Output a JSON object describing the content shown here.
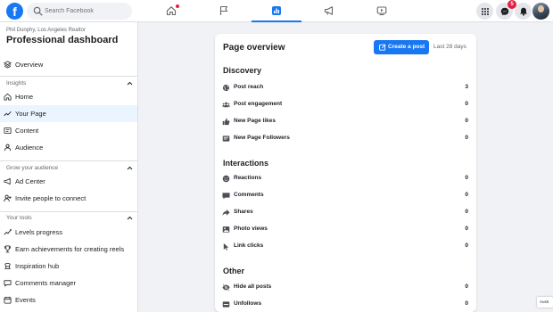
{
  "topbar": {
    "logo": "f",
    "search_placeholder": "Search Facebook",
    "tabs": [
      {
        "icon": "home-icon",
        "active": false,
        "has_dot": true
      },
      {
        "icon": "flag-icon",
        "active": false,
        "has_dot": false
      },
      {
        "icon": "dashboard-icon",
        "active": true,
        "has_dot": false
      },
      {
        "icon": "megaphone-icon",
        "active": false,
        "has_dot": false
      },
      {
        "icon": "video-icon",
        "active": false,
        "has_dot": false
      }
    ],
    "right": {
      "menu_icon": "grid-menu-icon",
      "messenger_icon": "messenger-icon",
      "messenger_badge": "5",
      "notifications_icon": "bell-icon"
    },
    "accent": "#1877f2"
  },
  "sidebar": {
    "profile_subtitle": "Phil Dunphy, Los Angeles Realtor",
    "title": "Professional dashboard",
    "overview_label": "Overview",
    "insights_header": "Insights",
    "insights_items": [
      {
        "label": "Home",
        "icon": "home-icon"
      },
      {
        "label": "Your Page",
        "icon": "trend-icon",
        "active": true
      },
      {
        "label": "Content",
        "icon": "content-icon"
      },
      {
        "label": "Audience",
        "icon": "audience-icon"
      }
    ],
    "grow_header": "Grow your audience",
    "grow_items": [
      {
        "label": "Ad Center",
        "icon": "megaphone-icon"
      },
      {
        "label": "Invite people to connect",
        "icon": "invite-icon"
      }
    ],
    "tools_header": "Your tools",
    "tools_items": [
      {
        "label": "Levels progress",
        "icon": "levels-icon"
      },
      {
        "label": "Earn achievements for creating reels",
        "icon": "trophy-icon"
      },
      {
        "label": "Inspiration hub",
        "icon": "bulb-icon"
      },
      {
        "label": "Comments manager",
        "icon": "comments-icon"
      },
      {
        "label": "Events",
        "icon": "calendar-icon"
      }
    ]
  },
  "overview": {
    "title": "Page overview",
    "create_button": "Create a post",
    "range": "Last 28 days",
    "groups": [
      {
        "title": "Discovery",
        "metrics": [
          {
            "label": "Post reach",
            "value": "3",
            "icon": "globe-icon"
          },
          {
            "label": "Post engagement",
            "value": "0",
            "icon": "people-icon"
          },
          {
            "label": "New Page likes",
            "value": "0",
            "icon": "thumbs-up-icon"
          },
          {
            "label": "New Page Followers",
            "value": "0",
            "icon": "followers-icon"
          }
        ]
      },
      {
        "title": "Interactions",
        "metrics": [
          {
            "label": "Reactions",
            "value": "0",
            "icon": "smiley-icon"
          },
          {
            "label": "Comments",
            "value": "0",
            "icon": "comment-icon"
          },
          {
            "label": "Shares",
            "value": "0",
            "icon": "share-icon"
          },
          {
            "label": "Photo views",
            "value": "0",
            "icon": "photo-icon"
          },
          {
            "label": "Link clicks",
            "value": "0",
            "icon": "cursor-icon"
          }
        ]
      },
      {
        "title": "Other",
        "metrics": [
          {
            "label": "Hide all posts",
            "value": "0",
            "icon": "hide-icon"
          },
          {
            "label": "Unfollows",
            "value": "0",
            "icon": "unfollow-icon"
          }
        ]
      }
    ]
  },
  "corner_tag": "Austi"
}
